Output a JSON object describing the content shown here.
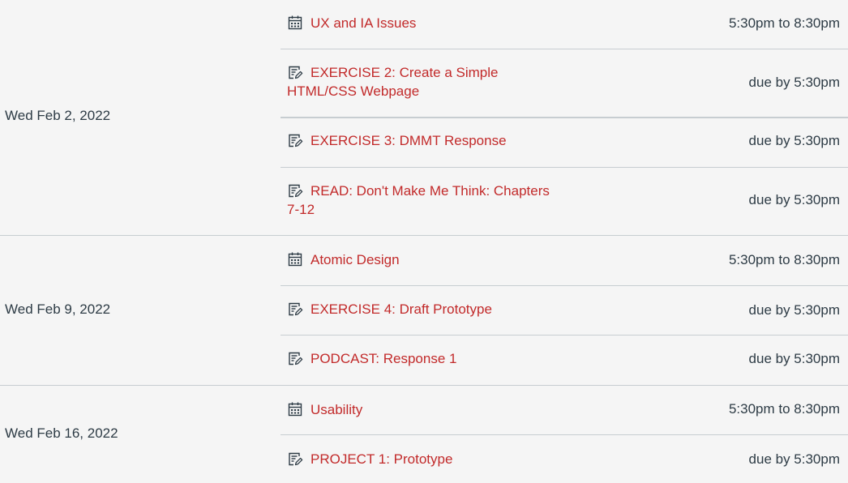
{
  "groups": [
    {
      "date": "Wed Feb 2, 2022",
      "items": [
        {
          "icon": "calendar-icon",
          "title": "UX and IA Issues",
          "meta": "5:30pm to 8:30pm"
        },
        {
          "icon": "assignment-icon",
          "title": "EXERCISE 2: Create a Simple HTML/CSS Webpage",
          "meta": "due by 5:30pm"
        },
        {
          "icon": "assignment-icon",
          "title": "EXERCISE 3: DMMT Response",
          "meta": "due by 5:30pm"
        },
        {
          "icon": "assignment-icon",
          "title": "READ: Don't Make Me Think: Chapters 7-12",
          "meta": "due by 5:30pm"
        }
      ]
    },
    {
      "date": "Wed Feb 9, 2022",
      "items": [
        {
          "icon": "calendar-icon",
          "title": "Atomic Design",
          "meta": "5:30pm to 8:30pm"
        },
        {
          "icon": "assignment-icon",
          "title": "EXERCISE 4: Draft Prototype",
          "meta": "due by 5:30pm"
        },
        {
          "icon": "assignment-icon",
          "title": "PODCAST: Response 1",
          "meta": "due by 5:30pm"
        }
      ]
    },
    {
      "date": "Wed Feb 16, 2022",
      "items": [
        {
          "icon": "calendar-icon",
          "title": "Usability",
          "meta": "5:30pm to 8:30pm"
        },
        {
          "icon": "assignment-icon",
          "title": "PROJECT 1: Prototype",
          "meta": "due by 5:30pm"
        }
      ]
    }
  ],
  "colors": {
    "link": "#c22a2a",
    "text": "#2d3b45",
    "divider": "#c7cdd1",
    "background": "#f5f5f5"
  }
}
